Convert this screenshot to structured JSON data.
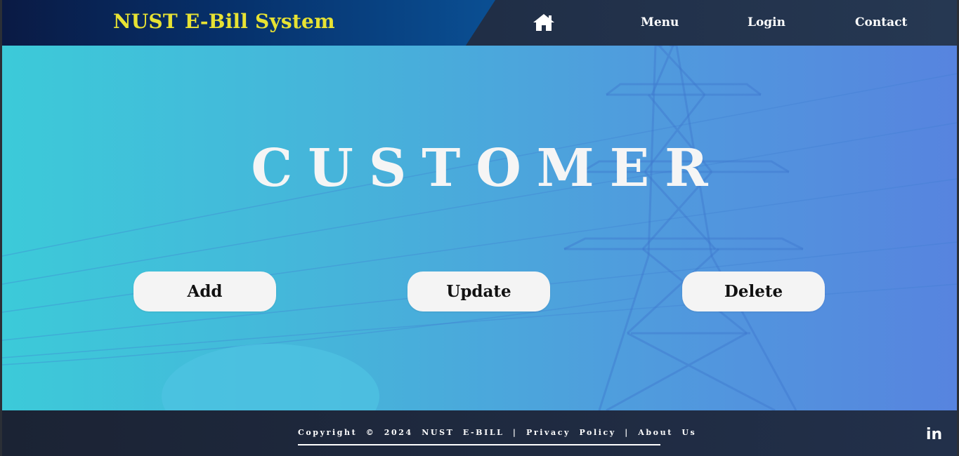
{
  "header": {
    "brand": "NUST E-Bill System",
    "nav": {
      "home_icon": "home-icon",
      "menu": "Menu",
      "login": "Login",
      "contact": "Contact"
    }
  },
  "hero": {
    "title": "CUSTOMER",
    "buttons": {
      "add": "Add",
      "update": "Update",
      "delete": "Delete"
    }
  },
  "footer": {
    "copyright": "Copyright © 2024 NUST E-BILL | Privacy Policy | About Us",
    "social_icon": "linkedin-icon",
    "social_label": "in"
  },
  "colors": {
    "brand_text": "#e7e233",
    "hero_gradient_start": "#3ccad9",
    "hero_gradient_end": "#5784df",
    "button_bg": "#f4f4f4"
  }
}
